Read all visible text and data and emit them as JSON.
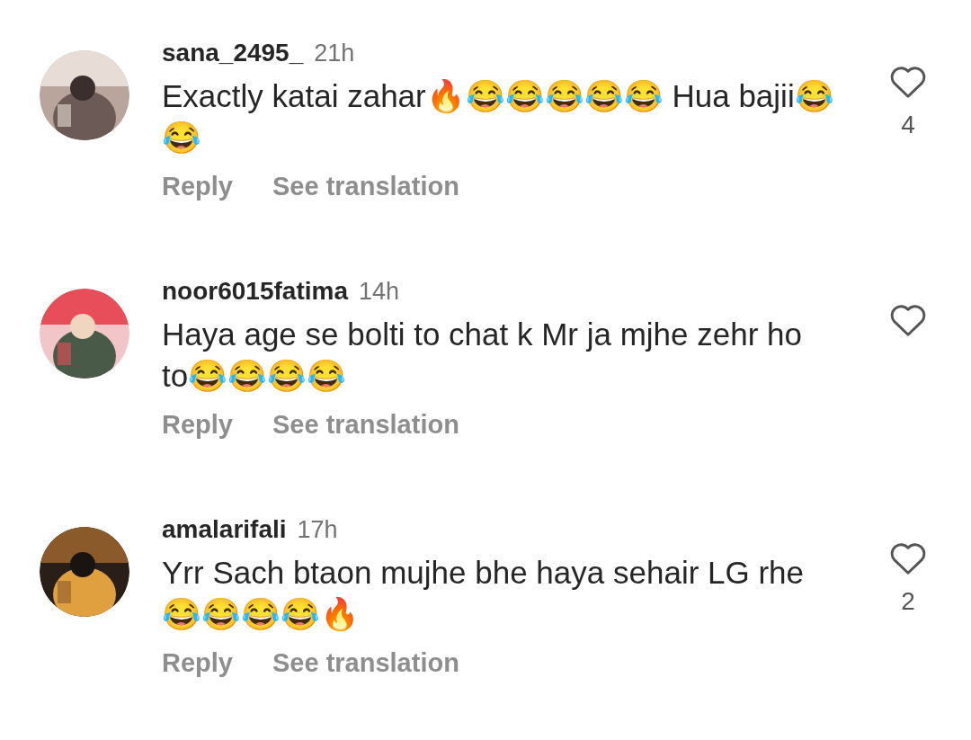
{
  "comments": [
    {
      "username": "sana_2495_",
      "time": "21h",
      "text": "Exactly katai zahar🔥😂😂😂😂😂 Hua bajii😂😂",
      "actions": [
        "Reply",
        "See translation"
      ],
      "likes": "4"
    },
    {
      "username": "noor6015fatima",
      "time": "14h",
      "text": "Haya age se bolti to chat k Mr ja mjhe zehr ho to😂😂😂😂",
      "actions": [
        "Reply",
        "See translation"
      ]
    },
    {
      "username": "amalarifali",
      "time": "17h",
      "text": "Yrr Sach btaon mujhe bhe haya sehair LG rhe😂😂😂😂🔥",
      "actions": [
        "Reply",
        "See translation"
      ],
      "likes": "2"
    }
  ]
}
